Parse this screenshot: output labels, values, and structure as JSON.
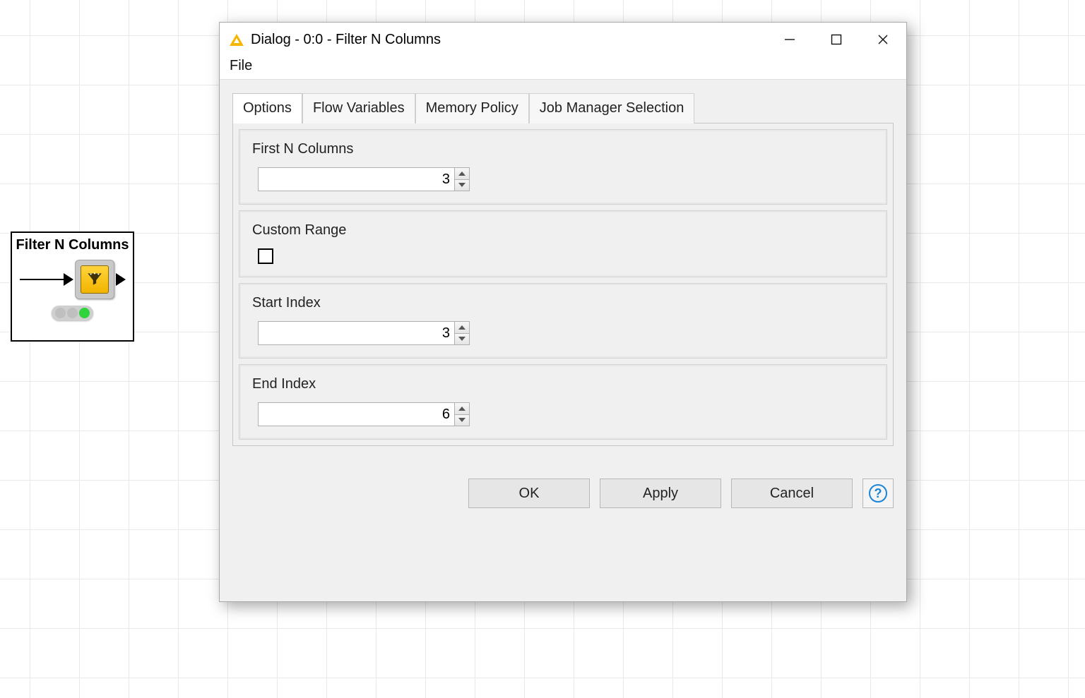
{
  "canvas": {
    "node": {
      "title": "Filter N Columns",
      "status": "ready"
    }
  },
  "dialog": {
    "title": "Dialog - 0:0 - Filter N Columns",
    "menu": {
      "file": "File"
    },
    "tabs": [
      {
        "label": "Options",
        "active": true
      },
      {
        "label": "Flow Variables",
        "active": false
      },
      {
        "label": "Memory Policy",
        "active": false
      },
      {
        "label": "Job Manager Selection",
        "active": false
      }
    ],
    "options": {
      "first_n": {
        "label": "First N Columns",
        "value": "3"
      },
      "custom_range": {
        "label": "Custom Range",
        "checked": false
      },
      "start_index": {
        "label": "Start Index",
        "value": "3"
      },
      "end_index": {
        "label": "End Index",
        "value": "6"
      }
    },
    "buttons": {
      "ok": "OK",
      "apply": "Apply",
      "cancel": "Cancel",
      "help_glyph": "?"
    }
  }
}
